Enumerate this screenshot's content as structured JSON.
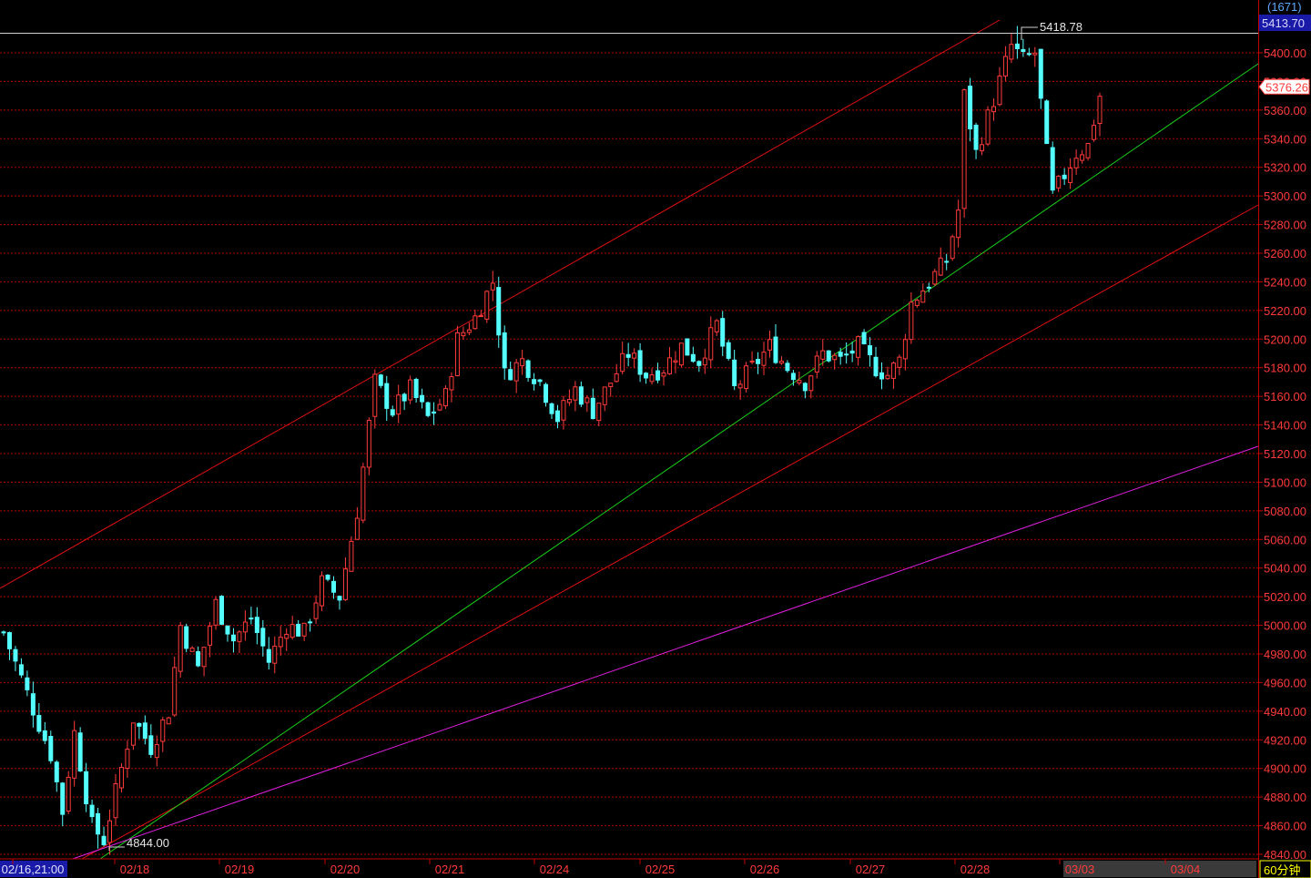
{
  "header": {
    "count_label": "(1671)",
    "price_box": "5413.70",
    "last_price_tag": "5376.26",
    "period_label": "60分钟"
  },
  "colors": {
    "background": "#000000",
    "up_candle": "#ff3b3b",
    "down_candle": "#54ffff",
    "grid": "#b00000",
    "channel_lines": "#e01010",
    "mid_trendline": "#19d019",
    "long_trendline": "#e020e0",
    "axis_text": "#ff3a3a",
    "price_box_bg": "#1a1aa8"
  },
  "chart_data": {
    "type": "candlestick",
    "ylim": [
      4830,
      5430
    ],
    "y_ticks": [
      4840,
      4860,
      4880,
      4900,
      4920,
      4940,
      4960,
      4980,
      5000,
      5020,
      5040,
      5060,
      5080,
      5100,
      5120,
      5140,
      5160,
      5180,
      5200,
      5220,
      5240,
      5260,
      5280,
      5300,
      5320,
      5340,
      5360,
      5380,
      5400
    ],
    "y_tick_labels": [
      "4840.00",
      "4860.00",
      "4880.00",
      "4900.00",
      "4920.00",
      "4940.00",
      "4960.00",
      "4980.00",
      "5000.00",
      "5020.00",
      "5040.00",
      "5060.00",
      "5080.00",
      "5100.00",
      "5120.00",
      "5140.00",
      "5160.00",
      "5180.00",
      "5200.00",
      "5220.00",
      "5240.00",
      "5260.00",
      "5280.00",
      "5300.00",
      "5320.00",
      "5340.00",
      "5360.00",
      "5380.00",
      "5400.00"
    ],
    "x_labels": [
      "02/16,21:00",
      "02/18",
      "02/19",
      "02/20",
      "02/21",
      "02/24",
      "02/25",
      "02/26",
      "02/27",
      "02/28",
      "03/03",
      "03/04"
    ],
    "annotations": [
      {
        "label": "5418.78",
        "value": 5418.78
      },
      {
        "label": "4844.00",
        "value": 4844.0
      }
    ],
    "high_line_value": 5413.7,
    "last_price": 5376.26,
    "anchors": [
      [
        0,
        4995
      ],
      [
        8,
        4910
      ],
      [
        10,
        4870
      ],
      [
        12,
        4925
      ],
      [
        15,
        4860
      ],
      [
        17,
        4850
      ],
      [
        20,
        4900
      ],
      [
        22,
        4935
      ],
      [
        25,
        4915
      ],
      [
        28,
        4940
      ],
      [
        30,
        5000
      ],
      [
        33,
        4970
      ],
      [
        36,
        5015
      ],
      [
        39,
        4990
      ],
      [
        42,
        5005
      ],
      [
        45,
        4975
      ],
      [
        48,
        5000
      ],
      [
        51,
        4995
      ],
      [
        54,
        5030
      ],
      [
        57,
        5020
      ],
      [
        60,
        5080
      ],
      [
        63,
        5170
      ],
      [
        66,
        5150
      ],
      [
        69,
        5165
      ],
      [
        72,
        5145
      ],
      [
        75,
        5160
      ],
      [
        77,
        5200
      ],
      [
        80,
        5215
      ],
      [
        83,
        5240
      ],
      [
        85,
        5175
      ],
      [
        88,
        5185
      ],
      [
        91,
        5170
      ],
      [
        94,
        5145
      ],
      [
        97,
        5165
      ],
      [
        100,
        5150
      ],
      [
        103,
        5170
      ],
      [
        106,
        5190
      ],
      [
        109,
        5175
      ],
      [
        112,
        5180
      ],
      [
        115,
        5195
      ],
      [
        118,
        5185
      ],
      [
        121,
        5210
      ],
      [
        124,
        5165
      ],
      [
        127,
        5180
      ],
      [
        130,
        5195
      ],
      [
        133,
        5180
      ],
      [
        136,
        5170
      ],
      [
        139,
        5190
      ],
      [
        142,
        5185
      ],
      [
        145,
        5195
      ],
      [
        148,
        5180
      ],
      [
        150,
        5175
      ],
      [
        152,
        5185
      ],
      [
        154,
        5225
      ],
      [
        157,
        5240
      ],
      [
        160,
        5255
      ],
      [
        162,
        5290
      ],
      [
        163,
        5370
      ],
      [
        165,
        5330
      ],
      [
        167,
        5355
      ],
      [
        169,
        5380
      ],
      [
        171,
        5405
      ],
      [
        173,
        5395
      ],
      [
        175,
        5400
      ],
      [
        177,
        5330
      ],
      [
        178,
        5300
      ],
      [
        180,
        5315
      ],
      [
        182,
        5330
      ],
      [
        184,
        5335
      ],
      [
        186,
        5370
      ]
    ],
    "candle_count": 187
  }
}
